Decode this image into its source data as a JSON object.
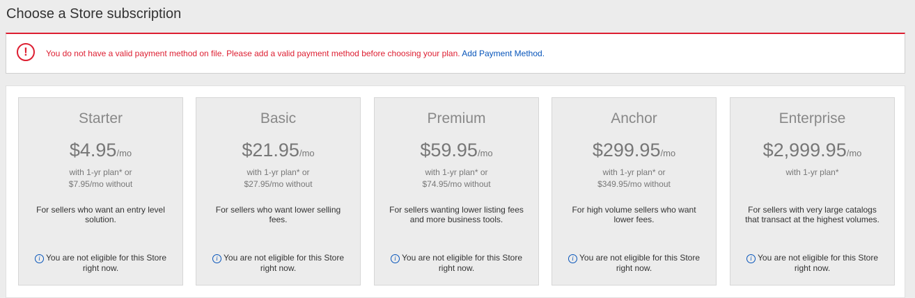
{
  "page": {
    "title": "Choose a Store subscription"
  },
  "alert": {
    "icon": "exclamation-icon",
    "message": "You do not have a valid payment method on file. Please add a valid payment method before choosing your plan.",
    "link_text": "Add Payment Method",
    "trailing": ".",
    "color": "#dd1e31",
    "link_color": "#0654ba"
  },
  "plans": [
    {
      "name": "Starter",
      "price": "$4.95",
      "unit": "/mo",
      "terms_line1": "with 1-yr plan* or",
      "terms_line2": "$7.95/mo without",
      "description": "For sellers who want an entry level solution.",
      "eligibility": "You are not eligible for this Store right now."
    },
    {
      "name": "Basic",
      "price": "$21.95",
      "unit": "/mo",
      "terms_line1": "with 1-yr plan* or",
      "terms_line2": "$27.95/mo without",
      "description": "For sellers who want lower selling fees.",
      "eligibility": "You are not eligible for this Store right now."
    },
    {
      "name": "Premium",
      "price": "$59.95",
      "unit": "/mo",
      "terms_line1": "with 1-yr plan* or",
      "terms_line2": "$74.95/mo without",
      "description": "For sellers wanting lower listing fees and more business tools.",
      "eligibility": "You are not eligible for this Store right now."
    },
    {
      "name": "Anchor",
      "price": "$299.95",
      "unit": "/mo",
      "terms_line1": "with 1-yr plan* or",
      "terms_line2": "$349.95/mo without",
      "description": "For high volume sellers who want lower fees.",
      "eligibility": "You are not eligible for this Store right now."
    },
    {
      "name": "Enterprise",
      "price": "$2,999.95",
      "unit": "/mo",
      "terms_line1": "with 1-yr plan*",
      "terms_line2": "",
      "description": "For sellers with very large catalogs that transact at the highest volumes.",
      "eligibility": "You are not eligible for this Store right now."
    }
  ]
}
